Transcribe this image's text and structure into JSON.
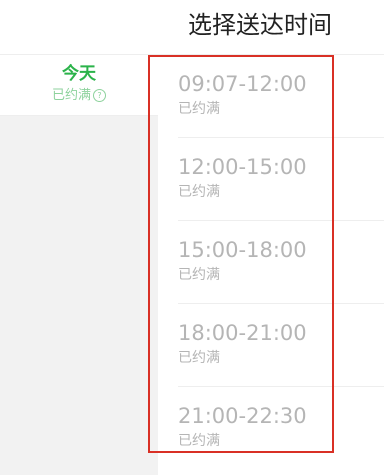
{
  "header": {
    "title": "选择送达时间"
  },
  "days": [
    {
      "name": "今天",
      "status": "已约满",
      "help_icon": "question-circle-icon"
    }
  ],
  "slots": [
    {
      "time": "09:07-12:00",
      "status": "已约满"
    },
    {
      "time": "12:00-15:00",
      "status": "已约满"
    },
    {
      "time": "15:00-18:00",
      "status": "已约满"
    },
    {
      "time": "18:00-21:00",
      "status": "已约满"
    },
    {
      "time": "21:00-22:30",
      "status": "已约满"
    }
  ],
  "colors": {
    "accent_green": "#2bb34a",
    "unavailable_gray": "#b5b5b5",
    "highlight_red": "#d93025"
  }
}
